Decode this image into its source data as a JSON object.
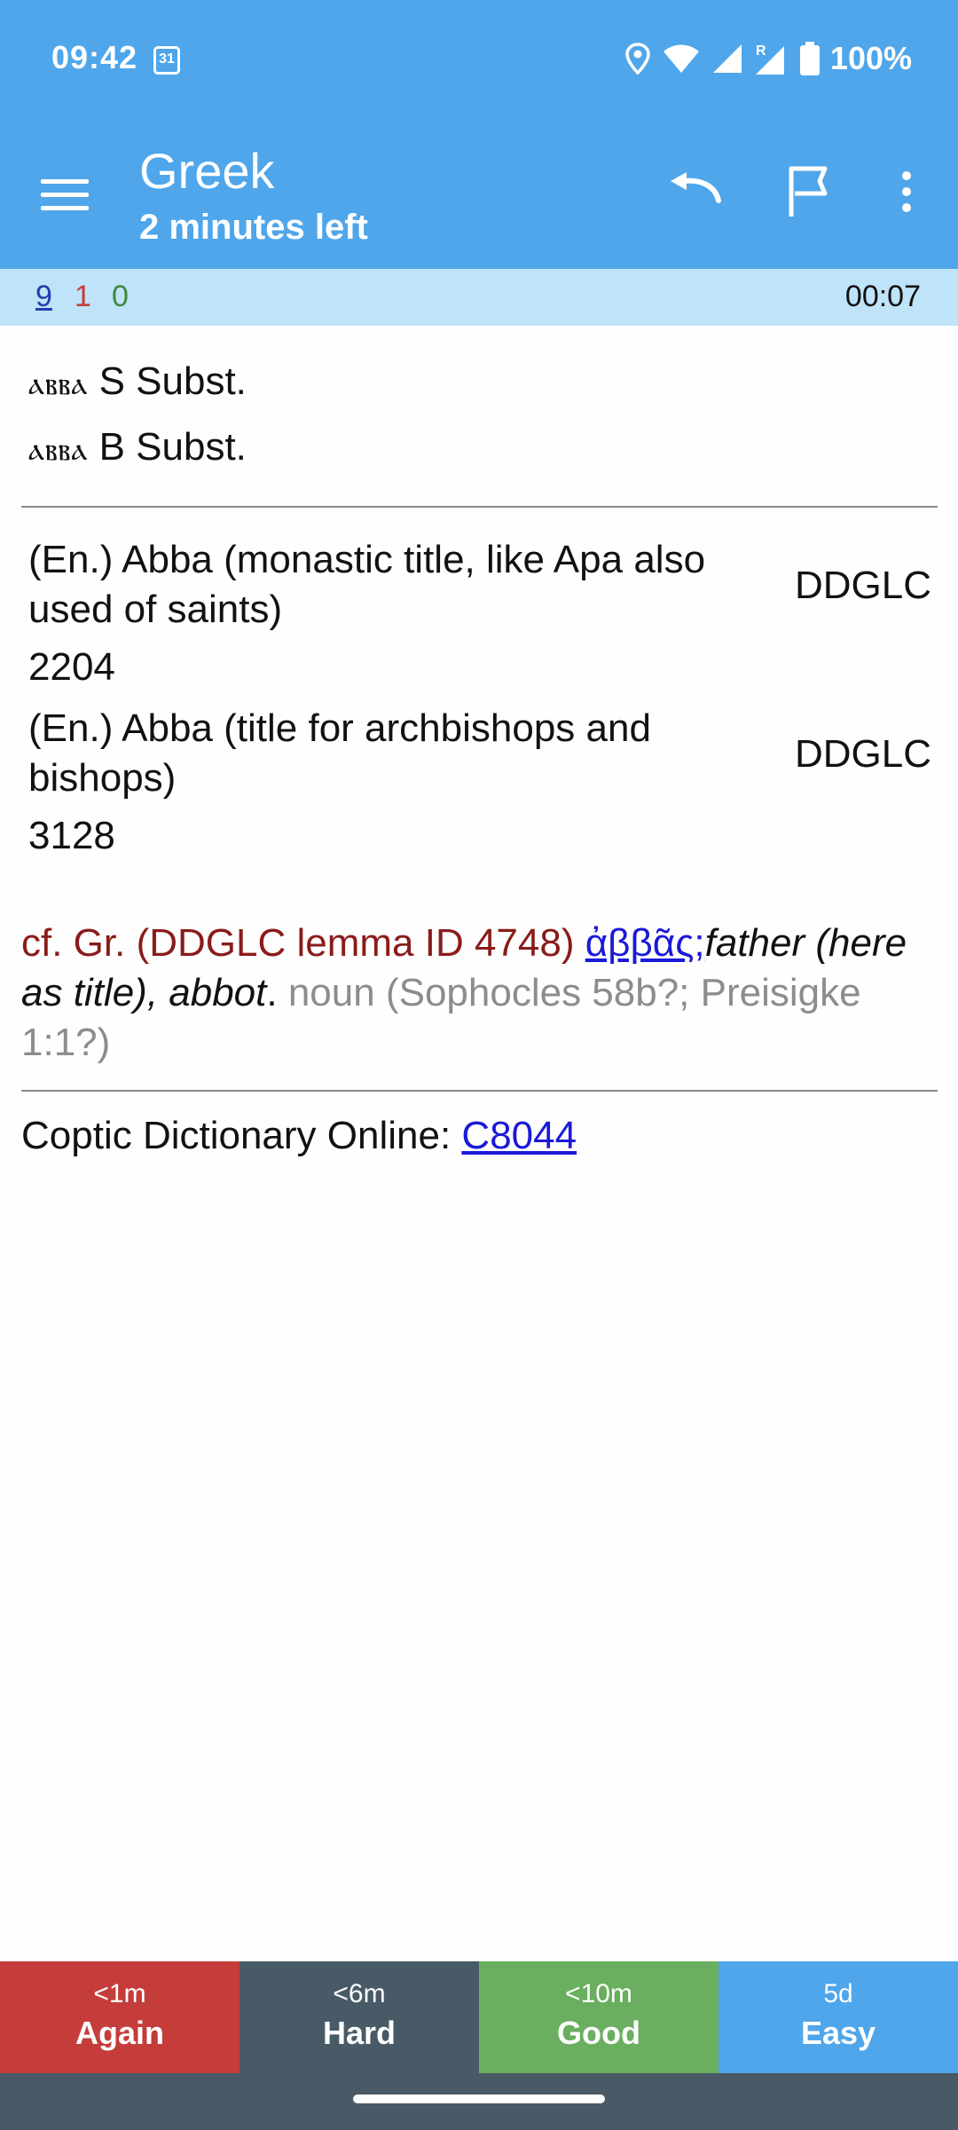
{
  "status": {
    "time": "09:42",
    "calendar_day": "31",
    "battery": "100%",
    "roaming": "R"
  },
  "toolbar": {
    "title": "Greek",
    "subtitle": "2 minutes left"
  },
  "counts": {
    "new": "9",
    "learning": "1",
    "review": "0",
    "timer": "00:07"
  },
  "entries": [
    {
      "coptic": "ⲁⲃⲃⲁ",
      "label": " S Subst."
    },
    {
      "coptic": "ⲁⲃⲃⲁ",
      "label": " B Subst."
    }
  ],
  "definitions": [
    {
      "text": "(En.) Abba (monastic title, like Apa also used of saints)",
      "source": "DDGLC",
      "id": "2204"
    },
    {
      "text": "(En.) Abba (title for archbishops and bishops)",
      "source": "DDGLC",
      "id": "3128"
    }
  ],
  "greek": {
    "prefix": "cf. Gr. (DDGLC lemma ID 4748) ",
    "lemma": "ἀββᾶς",
    "sep": ";",
    "meaning": "father (here as title), abbot",
    "period": ".",
    "grammar": " noun (Sophocles 58b?; Preisigke 1:1?)"
  },
  "cdo": {
    "label": "Coptic Dictionary Online: ",
    "link": "C8044"
  },
  "answers": [
    {
      "time": "<1m",
      "label": "Again",
      "color": "#c43d3b"
    },
    {
      "time": "<6m",
      "label": "Hard",
      "color": "#485a66"
    },
    {
      "time": "<10m",
      "label": "Good",
      "color": "#6aae5f"
    },
    {
      "time": "5d",
      "label": "Easy",
      "color": "#4fa6ea"
    }
  ],
  "colors": {
    "appbar": "#4fa6ea",
    "counts_bg": "#bfe3f8",
    "new": "#1f3fb0",
    "learning": "#c43d3b",
    "review": "#3b8a3b"
  }
}
